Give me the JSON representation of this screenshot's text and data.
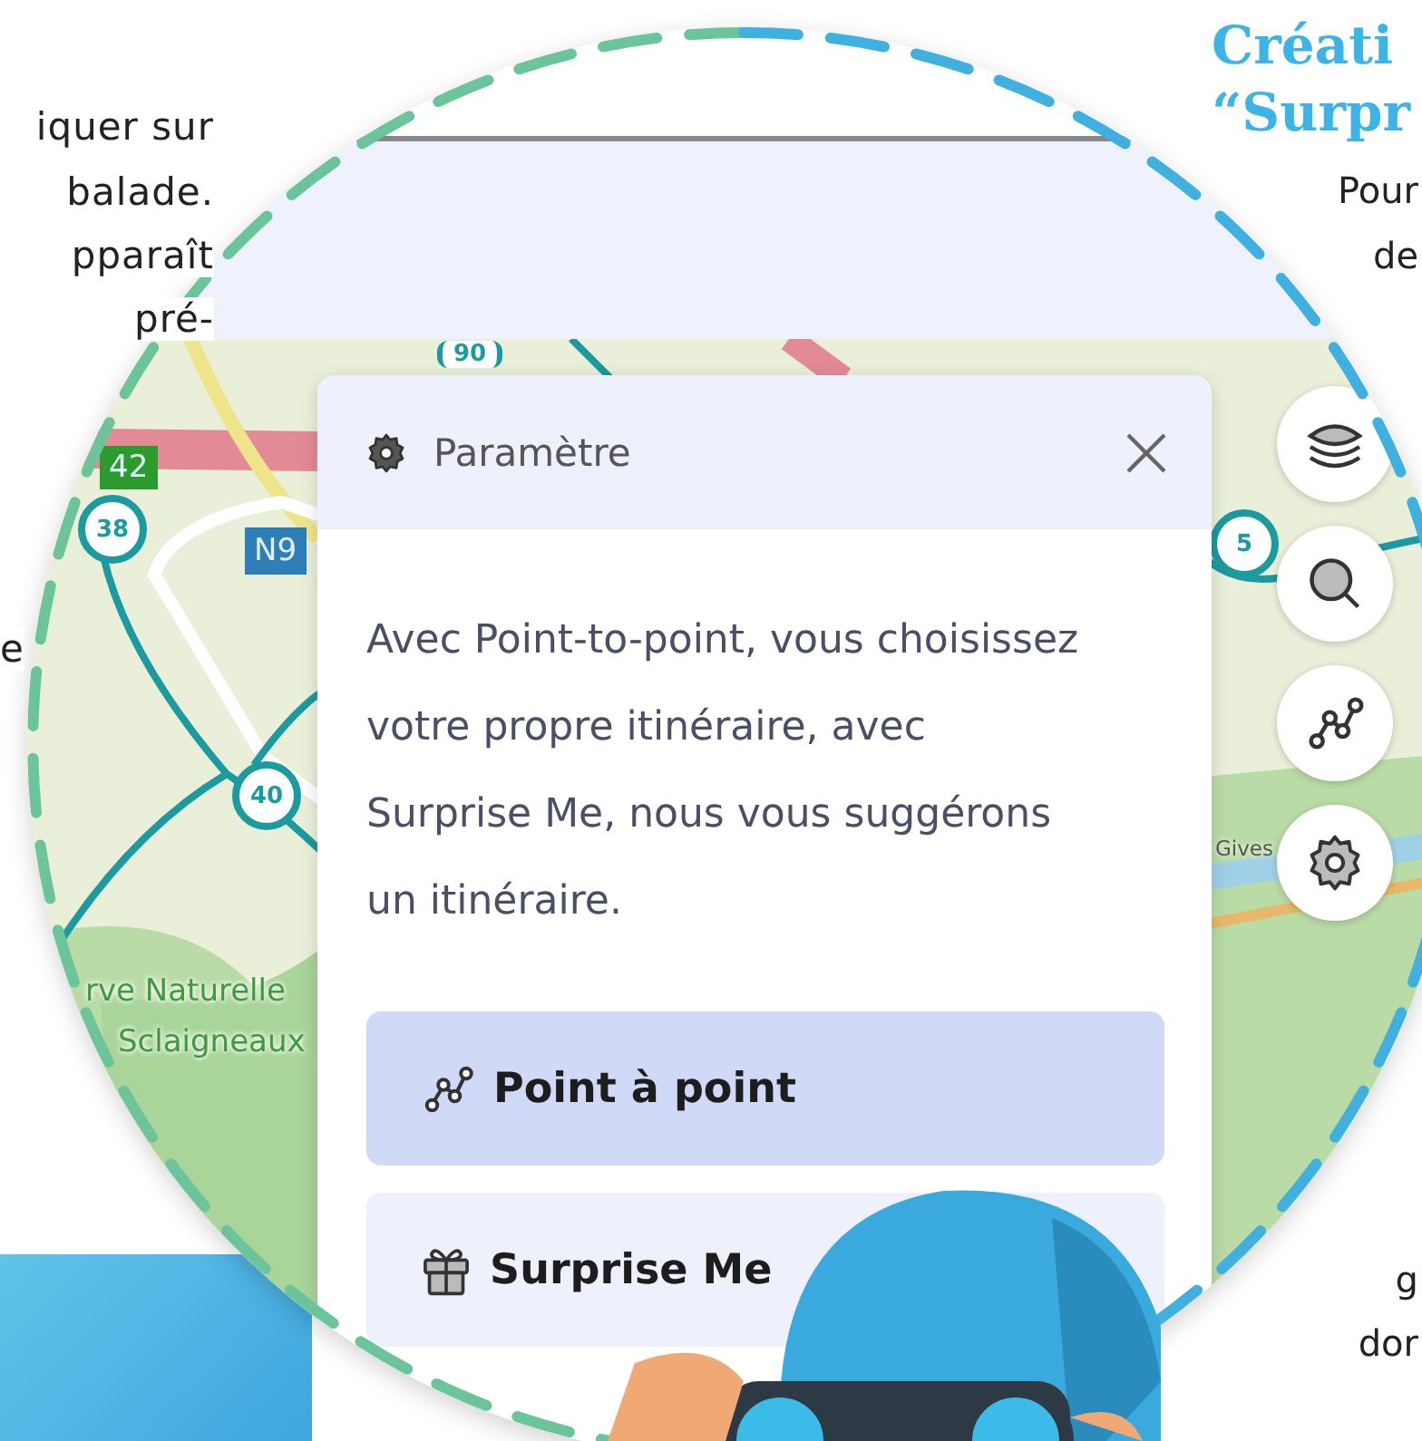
{
  "left_text": [
    "iquer sur",
    "balade.",
    "pparaît",
    "pré-",
    "e"
  ],
  "right_heading": [
    "Créati",
    "“Surpr"
  ],
  "right_text": [
    "Pour",
    "de",
    "g",
    "dor"
  ],
  "map": {
    "labels": [
      {
        "text": "90",
        "kind": "shield"
      },
      {
        "text": "42",
        "kind": "green-box"
      },
      {
        "text": "38",
        "kind": "node"
      },
      {
        "text": "N9",
        "kind": "blue-box"
      },
      {
        "text": "40",
        "kind": "node"
      },
      {
        "text": "5",
        "kind": "node"
      },
      {
        "text": "rve Naturelle",
        "kind": "area"
      },
      {
        "text": "Sclaigneaux",
        "kind": "area"
      },
      {
        "text": "Gives",
        "kind": "place"
      }
    ]
  },
  "dialog": {
    "title": "Paramètre",
    "body": "Avec Point-to-point, vous choisissez votre propre itinéraire, avec Surprise Me, nous vous suggérons un itinéraire.",
    "options": [
      {
        "label": "Point à point",
        "kind": "route",
        "selected": true
      },
      {
        "label": "Surprise Me",
        "kind": "gift",
        "selected": false
      }
    ]
  },
  "map_controls": [
    {
      "kind": "layers"
    },
    {
      "kind": "search"
    },
    {
      "kind": "route"
    },
    {
      "kind": "settings"
    }
  ]
}
